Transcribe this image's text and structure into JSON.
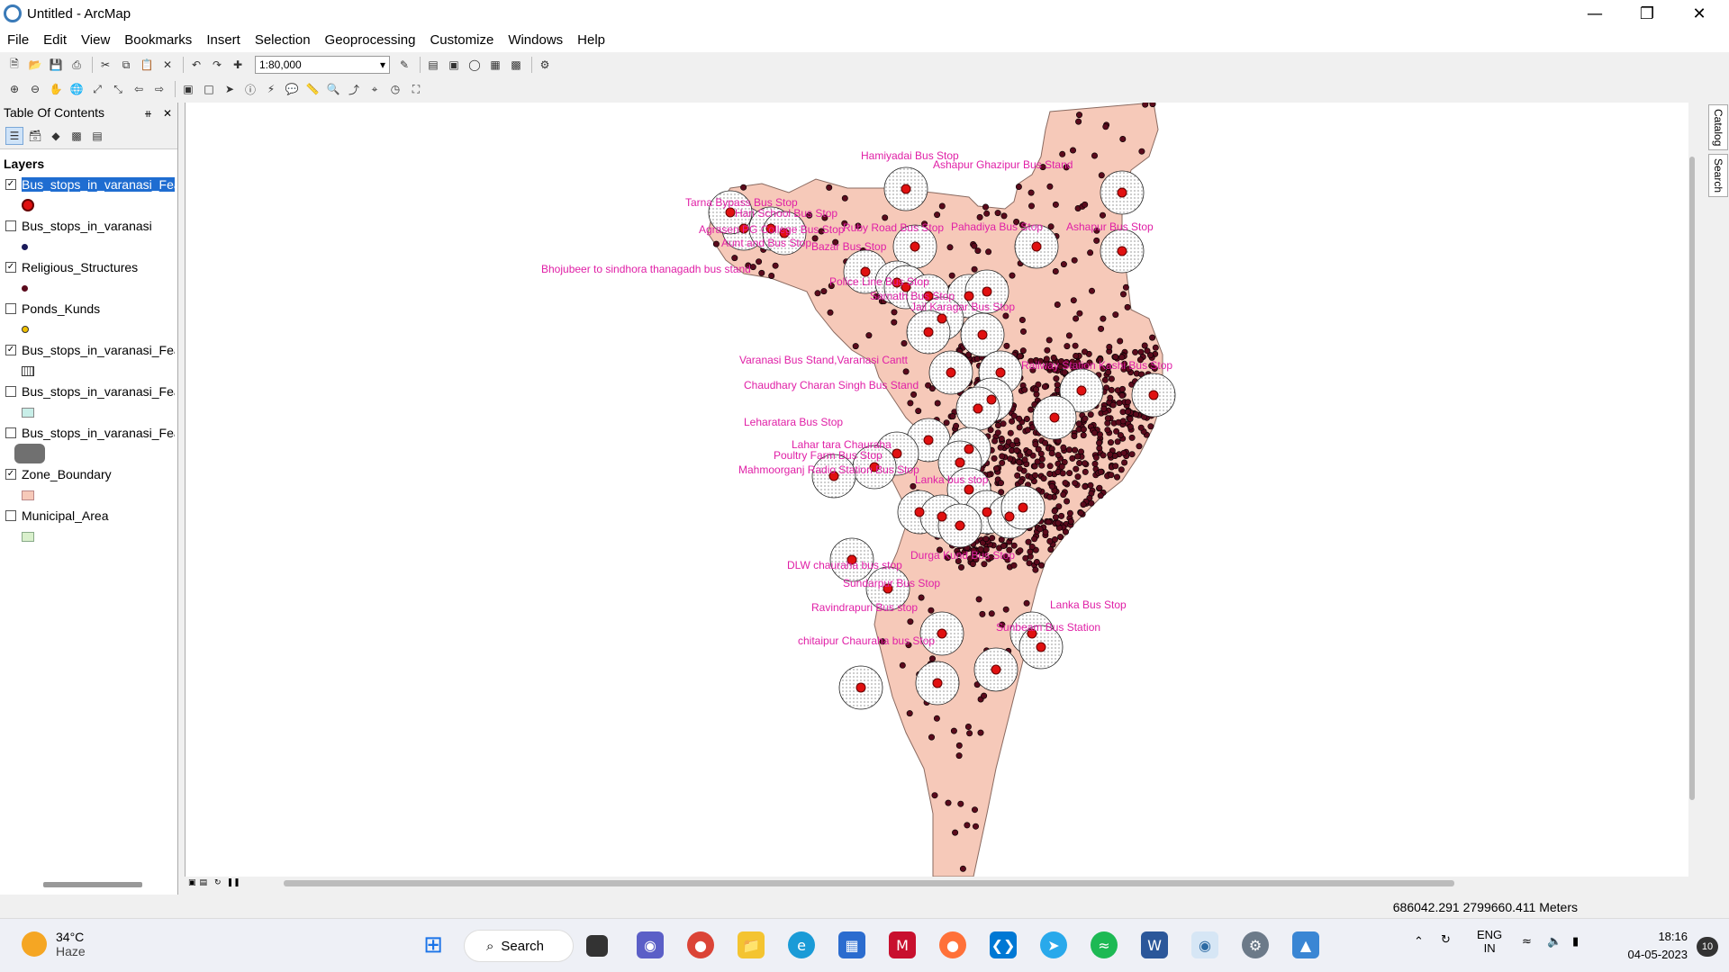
{
  "window": {
    "title": "Untitled - ArcMap",
    "min_icon": "minimize-icon",
    "restore_icon": "restore-icon",
    "close_icon": "close-icon"
  },
  "menu": [
    "File",
    "Edit",
    "View",
    "Bookmarks",
    "Insert",
    "Selection",
    "Geoprocessing",
    "Customize",
    "Windows",
    "Help"
  ],
  "toolbar": {
    "scale": "1:80,000"
  },
  "toc": {
    "title": "Table Of Contents",
    "layers_heading": "Layers",
    "layers": [
      {
        "name": "Bus_stops_in_varanasi_Fea",
        "checked": true,
        "selected": true,
        "symbol": "red-dot"
      },
      {
        "name": "Bus_stops_in_varanasi",
        "checked": false,
        "selected": false,
        "symbol": "navy-dot"
      },
      {
        "name": "Religious_Structures",
        "checked": true,
        "selected": false,
        "symbol": "maroon-dot"
      },
      {
        "name": "Ponds_Kunds",
        "checked": false,
        "selected": false,
        "symbol": "yellow-dot"
      },
      {
        "name": "Bus_stops_in_varanasi_Fea",
        "checked": true,
        "selected": false,
        "symbol": "dotted-rect"
      },
      {
        "name": "Bus_stops_in_varanasi_Fea",
        "checked": false,
        "selected": false,
        "symbol": "cyan-rect"
      },
      {
        "name": "Bus_stops_in_varanasi_Fea",
        "checked": false,
        "selected": false,
        "symbol": "gray-rounded"
      },
      {
        "name": "Zone_Boundary",
        "checked": true,
        "selected": false,
        "symbol": "pink-rect"
      },
      {
        "name": "Municipal_Area",
        "checked": false,
        "selected": false,
        "symbol": "green-rect"
      }
    ]
  },
  "colors": {
    "zone_fill": "#f6c9b9",
    "buffer_fill": "#ffffff",
    "stop_red": "#e01010",
    "structure_maroon": "#5a0a1c",
    "label_magenta": "#e01fa6"
  },
  "map": {
    "labels": [
      "Hamiyadai Bus Stop",
      "Ashapur Ghazipur Bus Stand",
      "Tarna Bypass Bus Stop",
      "Hari School Bus Stop",
      "Agrasen PG College Bus Stop",
      "Ruby Road Bus Stop",
      "Pahadiya Bus Stop",
      "Ashapur Bus Stop",
      "Aunt and Bus Stop",
      "Bazar Bus Stop",
      "Bhojubeer to sindhora thanagadh bus stand",
      "Police Line Bus Stop",
      "Sarnath Bus Stop",
      "Jail Karagar Bus Stop",
      "Varanasi Bus Stand,Varanasi Cantt",
      "Railway Station Kashi Bus Stop",
      "Chaudhary Charan Singh Bus Stand",
      "Leharatara Bus Stop",
      "Lahar tara Chauraha",
      "Poultry Farm Bus Stop",
      "Mahmoorganj Radio Station Bus Stop",
      "Lanka bus stop",
      "Durga Kund Bus Stop",
      "DLW chauraha bus stop",
      "Sundarpur Bus Stop",
      "Ravindrapuri Bus stop",
      "Lanka Bus Stop",
      "Sunbeam Bus Station",
      "chitaipur Chauraha bus Stop"
    ]
  },
  "status": {
    "coordinates": "686042.291  2799660.411 Meters"
  },
  "taskbar": {
    "temperature": "34°C",
    "condition": "Haze",
    "search_label": "Search",
    "lang_top": "ENG",
    "lang_bottom": "IN",
    "time": "18:16",
    "date": "04-05-2023",
    "notifications": "10"
  },
  "side_tabs": [
    "Catalog",
    "Search"
  ]
}
